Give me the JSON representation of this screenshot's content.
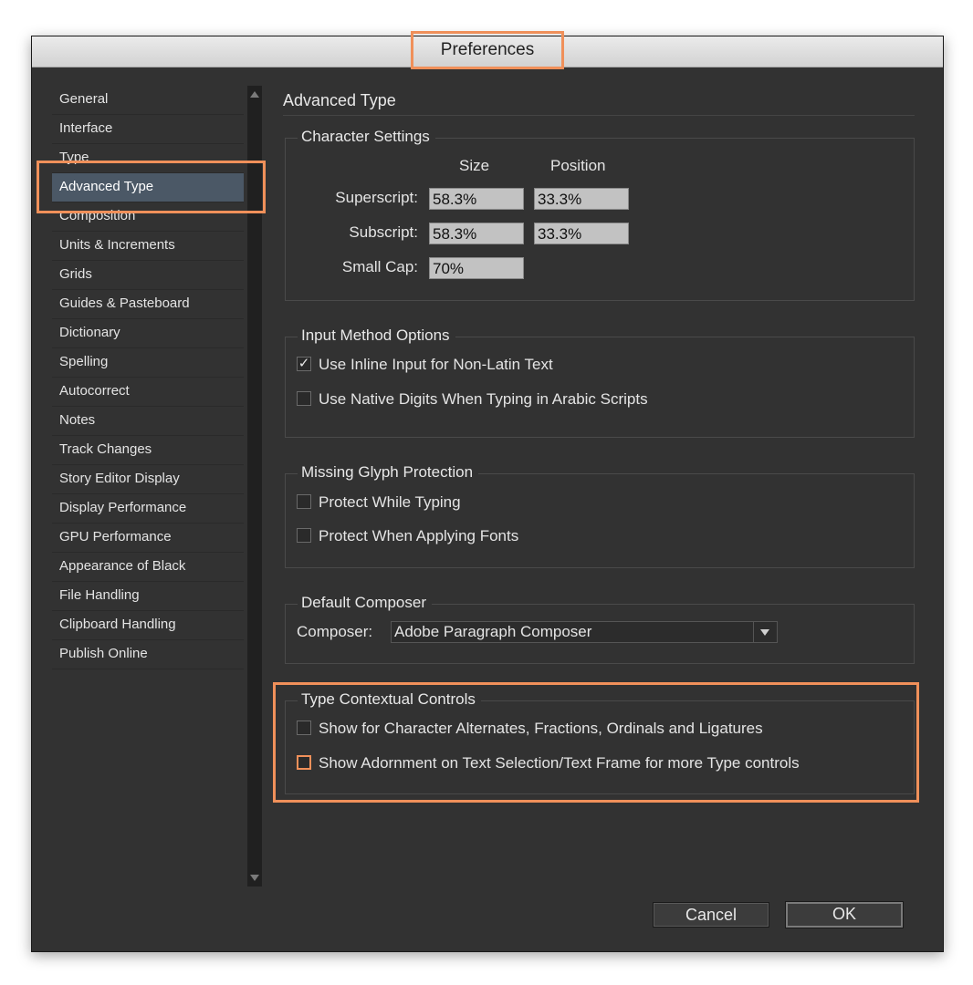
{
  "window": {
    "title": "Preferences"
  },
  "sidebar": {
    "items": [
      {
        "label": "General"
      },
      {
        "label": "Interface"
      },
      {
        "label": "Type"
      },
      {
        "label": "Advanced Type"
      },
      {
        "label": "Composition"
      },
      {
        "label": "Units & Increments"
      },
      {
        "label": "Grids"
      },
      {
        "label": "Guides & Pasteboard"
      },
      {
        "label": "Dictionary"
      },
      {
        "label": "Spelling"
      },
      {
        "label": "Autocorrect"
      },
      {
        "label": "Notes"
      },
      {
        "label": "Track Changes"
      },
      {
        "label": "Story Editor Display"
      },
      {
        "label": "Display Performance"
      },
      {
        "label": "GPU Performance"
      },
      {
        "label": "Appearance of Black"
      },
      {
        "label": "File Handling"
      },
      {
        "label": "Clipboard Handling"
      },
      {
        "label": "Publish Online"
      }
    ],
    "selected": "Advanced Type"
  },
  "main": {
    "title": "Advanced Type",
    "character_settings": {
      "legend": "Character Settings",
      "size_header": "Size",
      "position_header": "Position",
      "superscript_label": "Superscript:",
      "superscript_size": "58.3%",
      "superscript_position": "33.3%",
      "subscript_label": "Subscript:",
      "subscript_size": "58.3%",
      "subscript_position": "33.3%",
      "small_cap_label": "Small Cap:",
      "small_cap_value": "70%"
    },
    "input_method": {
      "legend": "Input Method Options",
      "inline_input_label": "Use Inline Input for Non-Latin Text",
      "inline_input_checked": true,
      "native_digits_label": "Use Native Digits When Typing in Arabic Scripts",
      "native_digits_checked": false
    },
    "missing_glyph": {
      "legend": "Missing Glyph Protection",
      "protect_typing_label": "Protect While Typing",
      "protect_typing_checked": false,
      "protect_fonts_label": "Protect When Applying Fonts",
      "protect_fonts_checked": false
    },
    "default_composer": {
      "legend": "Default Composer",
      "composer_label": "Composer:",
      "composer_value": "Adobe Paragraph Composer"
    },
    "type_contextual": {
      "legend": "Type Contextual Controls",
      "alternates_label": "Show for Character Alternates, Fractions, Ordinals and Ligatures",
      "alternates_checked": false,
      "adornment_label": "Show Adornment on Text Selection/Text Frame for more Type controls",
      "adornment_checked": false
    }
  },
  "buttons": {
    "cancel": "Cancel",
    "ok": "OK"
  },
  "colors": {
    "highlight": "#f0905a",
    "selected_item": "#4b5866",
    "dialog_bg": "#323232"
  }
}
